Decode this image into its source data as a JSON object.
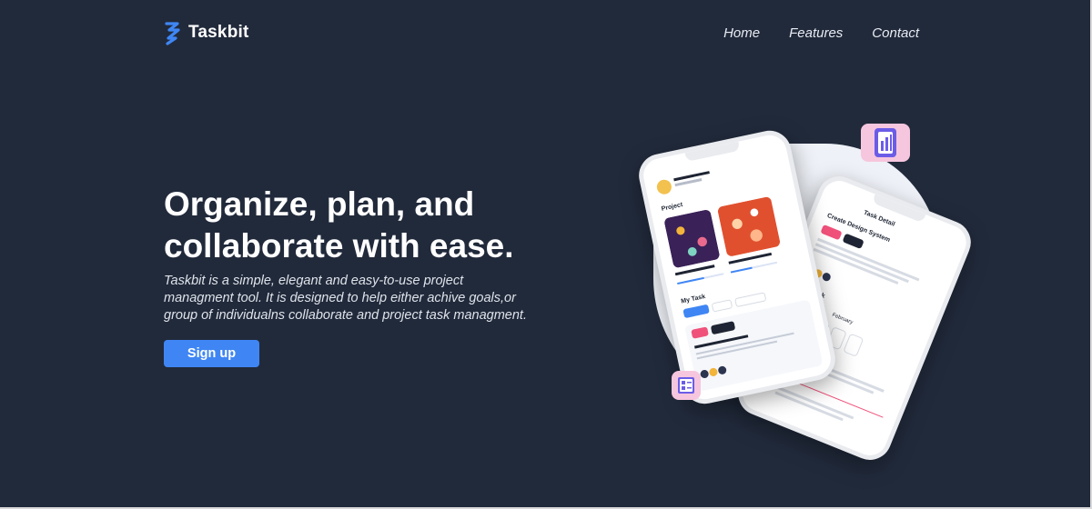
{
  "brand": {
    "name": "Taskbit",
    "logo_icon": "taskbit-logo-icon",
    "accent": "#3f86f4"
  },
  "nav": {
    "links": [
      "Home",
      "Features",
      "Contact"
    ]
  },
  "hero": {
    "title_line1": "Organize, plan, and",
    "title_line2": "collaborate with ease.",
    "description": "Taskbit is a simple, elegant and easy-to-use project managment tool. It is designed to help either achive goals,or group of individualns collaborate and project task managment.",
    "cta_label": "Sign up"
  },
  "colors": {
    "background": "#212a3b",
    "button": "#3f86f4",
    "text": "#ffffff"
  }
}
